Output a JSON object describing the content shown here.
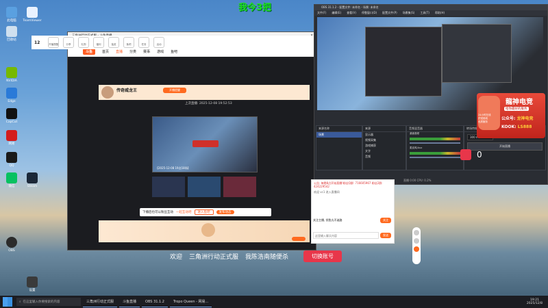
{
  "desktop": {
    "overlay_text": "我今3把",
    "banner_welcome": "欢迎",
    "banner_title": "三角洲行动正式服",
    "banner_user": "我陈浩南随便杀",
    "switch_account": "切换账号",
    "viewer_count": "0",
    "icons": [
      {
        "label": "此电脑",
        "color": "#5aa0e0"
      },
      {
        "label": "TeamViewer",
        "color": "#e9f2ff"
      },
      {
        "label": "回收站",
        "color": "#cfe0ef"
      },
      {
        "label": "Edge",
        "color": "#2a7ad8"
      },
      {
        "label": "NVIDIA",
        "color": "#76b900"
      },
      {
        "label": "CapCut",
        "color": "#111"
      },
      {
        "label": "网易",
        "color": "#d31d1d"
      },
      {
        "label": "QQ",
        "color": "#1a1a1a"
      },
      {
        "label": "微信",
        "color": "#07c160"
      },
      {
        "label": "Steam",
        "color": "#1b2838"
      },
      {
        "label": "OBS",
        "color": "#2b2b2b"
      },
      {
        "label": "设置",
        "color": "#3a3a3a"
      }
    ]
  },
  "browser": {
    "title": "三角洲行动正式服 - 斗鱼直播",
    "url": "https://www.douyu.com/beta/topic/gfjsdouhou/h5?rid=9122418&dyshid=7d6",
    "site_logo": "斗鱼",
    "nav": [
      "首页",
      "直播",
      "分类",
      "赛事",
      "游戏",
      "鱼吧"
    ],
    "nav_active": "直播",
    "streamer_name": "传奇威龙王",
    "stream_info": "上次直播: 2025-12-08 19:52:53",
    "thumb_caption": "【2025-12-08 19点18场】",
    "popup_text": "下播后也可以粉丝互动",
    "popup_link": "一起互动吧",
    "popup_btn1": "进入鱼吧",
    "popup_btn2": "发布动态",
    "tool_labels": [
      "12",
      "开播提醒",
      "分享",
      "礼物",
      "福利",
      "抽奖",
      "鱼吧",
      "任务",
      "活动"
    ],
    "bottom_btn": "开播提醒"
  },
  "obs": {
    "title": "OBS 31.1.2 - 配置文件: 未命名 - 场景: 未命名",
    "menu": [
      "文件(F)",
      "编辑(E)",
      "查看(V)",
      "停靠窗口(D)",
      "配置文件(P)",
      "场景集(S)",
      "工具(T)",
      "帮助(H)"
    ],
    "scenes_title": "来源名称",
    "scene_item": "场景",
    "sources_title": "来源",
    "sources": [
      "显示器",
      "视频采集",
      "游戏捕获",
      "文字",
      "音频"
    ],
    "mixer_title": "音频混音器",
    "mixer_channels": [
      "桌面音频",
      "麦克风/Aux"
    ],
    "transition_title": "转场特效",
    "transition_value": "300 ms",
    "start_stream": "开始直播",
    "status": "直播 0:00 CPU: 0.2%"
  },
  "chat": {
    "notice": "公告: 每晚8点开始直播!粉丝Q群: 716605967 粉丝2群: 424229542",
    "system_msg": "欢迎 vc1 进入直播间",
    "follow_prompt": "关注主播, 领鱼丸不迷路",
    "follow_btn": "关注",
    "input_placeholder": "这里输入聊天内容",
    "send_btn": "发送"
  },
  "ad": {
    "brand": "龍神电竞",
    "slogan": "给你最好的服务",
    "badge1": "24小时在线",
    "badge2": "护送前线",
    "badge3": "优质服务",
    "wechat_label": "公众号:",
    "wechat": "龙神电竞",
    "kook_label": "KOOK:",
    "kook": "LS888"
  },
  "taskbar": {
    "search_placeholder": "在这里输入你要搜索的内容",
    "items": [
      "三角洲行动正式服",
      "斗鱼直播",
      "OBS 31.1.2",
      "Tropo Queen - 网易..."
    ],
    "time": "19:21",
    "date": "2025/12/8"
  }
}
